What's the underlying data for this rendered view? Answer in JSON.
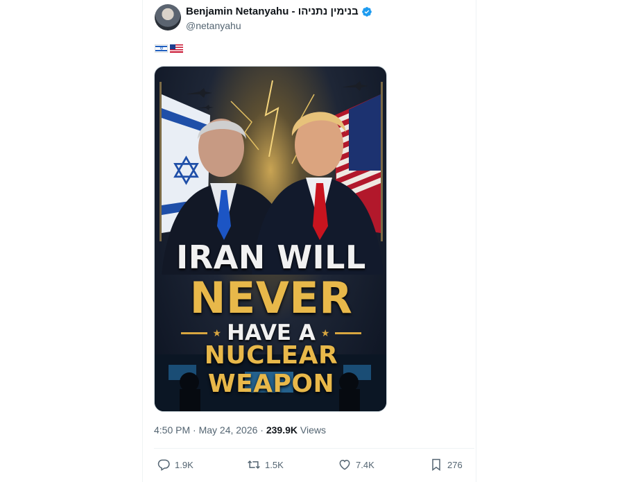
{
  "post": {
    "author": {
      "display_name": "Benjamin Netanyahu - בנימין נתניהו",
      "handle": "@netanyahu",
      "verified": true
    },
    "body_icons": [
      "israel-flag-icon",
      "usa-flag-icon"
    ],
    "media": {
      "text_line_1": "IRAN WILL",
      "text_line_2": "NEVER",
      "text_line_3": "HAVE A",
      "text_line_4": "NUCLEAR WEAPON"
    },
    "timestamp": "4:50 PM · May 24, 2026 · ",
    "views_count": "239.9K",
    "views_label": " Views",
    "actions": {
      "replies": "1.9K",
      "reposts": "1.5K",
      "likes": "7.4K",
      "bookmarks": "276"
    }
  },
  "colors": {
    "text_primary": "#0f1419",
    "text_secondary": "#536471",
    "verified_blue": "#1d9bf0",
    "poster_gold": "#e8b84a"
  }
}
